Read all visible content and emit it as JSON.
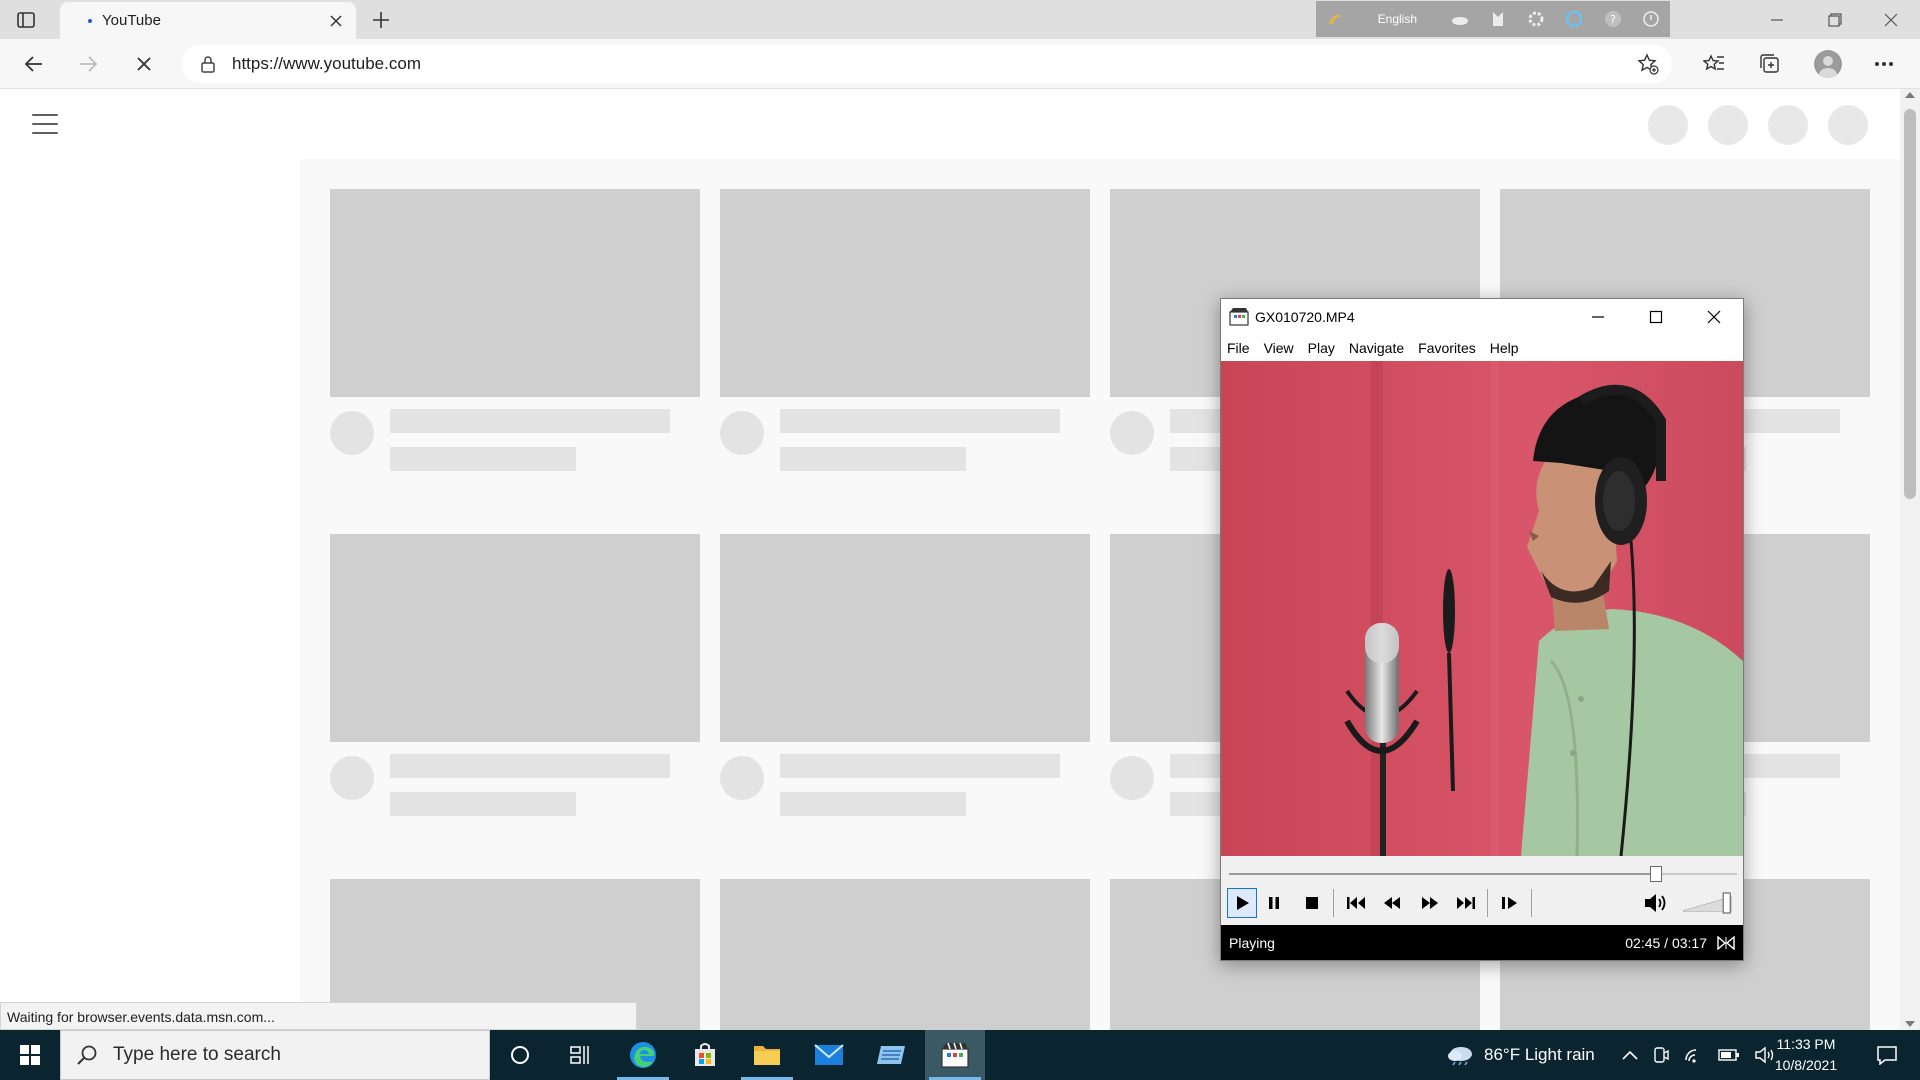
{
  "browser": {
    "tab_title": "YouTube",
    "url": "https://www.youtube.com",
    "ime_language": "English",
    "status_text": "Waiting for browser.events.data.msn.com..."
  },
  "player": {
    "window_title": "GX010720.MP4",
    "menu": [
      "File",
      "View",
      "Play",
      "Navigate",
      "Favorites",
      "Help"
    ],
    "state": "Playing",
    "time": "02:45 / 03:17",
    "progress": 0.84,
    "volume": 0.9
  },
  "taskbar": {
    "search_placeholder": "Type here to search",
    "weather": "86°F  Light rain",
    "time": "11:33 PM",
    "date": "10/8/2021"
  },
  "colors": {
    "accent_blue": "#1a6fd9",
    "taskbar_bg": "#0b2530",
    "skeleton": "#cfcfcf"
  }
}
